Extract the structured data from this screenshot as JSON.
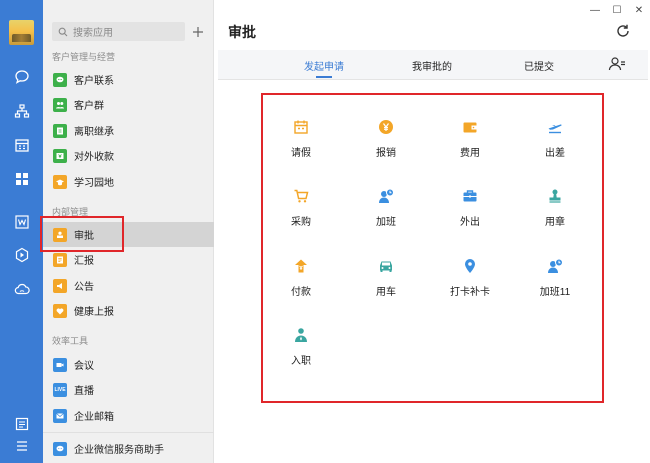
{
  "sidebar": {
    "search_placeholder": "搜索应用",
    "sections": [
      {
        "title": "客户管理与经营"
      },
      {
        "title": "内部管理"
      },
      {
        "title": "效率工具"
      }
    ],
    "items": [
      {
        "label": "客户联系",
        "color": "#3db04a",
        "icon": "chat-icon"
      },
      {
        "label": "客户群",
        "color": "#3db04a",
        "icon": "group-icon"
      },
      {
        "label": "离职继承",
        "color": "#3db04a",
        "icon": "handover-icon"
      },
      {
        "label": "对外收款",
        "color": "#3db04a",
        "icon": "payment-icon"
      },
      {
        "label": "学习园地",
        "color": "#f3a628",
        "icon": "study-icon"
      },
      {
        "label": "审批",
        "color": "#f3a628",
        "icon": "approval-icon"
      },
      {
        "label": "汇报",
        "color": "#f3a628",
        "icon": "report-icon"
      },
      {
        "label": "公告",
        "color": "#f3a628",
        "icon": "announcement-icon"
      },
      {
        "label": "健康上报",
        "color": "#f3a628",
        "icon": "health-icon"
      },
      {
        "label": "会议",
        "color": "#3b8fe0",
        "icon": "meeting-icon"
      },
      {
        "label": "直播",
        "color": "#3b8fe0",
        "icon": "live-icon"
      },
      {
        "label": "企业邮箱",
        "color": "#3b8fe0",
        "icon": "mail-icon"
      },
      {
        "label": "企业微信服务商助手",
        "color": "#3b8fe0",
        "icon": "assistant-icon"
      }
    ],
    "live_badge": "LIVE"
  },
  "main": {
    "title": "审批",
    "tabs": [
      {
        "label": "发起申请",
        "active": true
      },
      {
        "label": "我审批的",
        "active": false
      },
      {
        "label": "已提交",
        "active": false
      }
    ],
    "apps": [
      {
        "label": "请假",
        "icon": "calendar-icon",
        "color": "#f3a628"
      },
      {
        "label": "报销",
        "icon": "yen-coin-icon",
        "color": "#f3a628"
      },
      {
        "label": "费用",
        "icon": "wallet-icon",
        "color": "#f3a628"
      },
      {
        "label": "出差",
        "icon": "plane-icon",
        "color": "#3b8fe0"
      },
      {
        "label": "采购",
        "icon": "cart-icon",
        "color": "#f3a628"
      },
      {
        "label": "加班",
        "icon": "user-clock-icon",
        "color": "#3b8fe0"
      },
      {
        "label": "外出",
        "icon": "briefcase-icon",
        "color": "#3b8fe0"
      },
      {
        "label": "用章",
        "icon": "stamp-icon",
        "color": "#3aa6a0"
      },
      {
        "label": "付款",
        "icon": "payment-out-icon",
        "color": "#f3a628"
      },
      {
        "label": "用车",
        "icon": "car-icon",
        "color": "#3aa6a0"
      },
      {
        "label": "打卡补卡",
        "icon": "location-pin-icon",
        "color": "#3b8fe0"
      },
      {
        "label": "加班11",
        "icon": "user-clock-icon",
        "color": "#3b8fe0"
      },
      {
        "label": "入职",
        "icon": "new-hire-icon",
        "color": "#3aa6a0"
      }
    ]
  },
  "window": {
    "minimize": "—",
    "maximize": "☐",
    "close": "✕"
  },
  "colors": {
    "rail": "#3b7cd4",
    "accent": "#3b7cd4",
    "highlight": "#e0262a"
  }
}
